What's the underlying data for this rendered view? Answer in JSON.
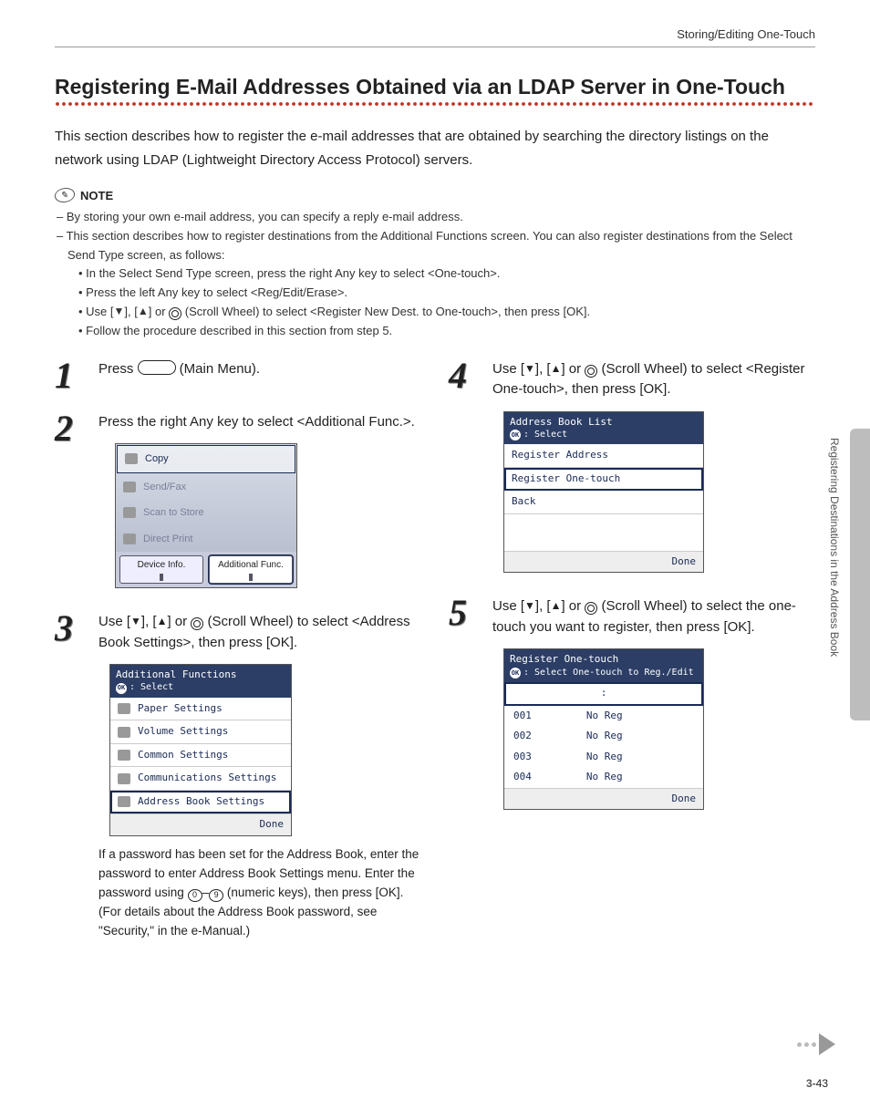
{
  "header": {
    "breadcrumb": "Storing/Editing One-Touch"
  },
  "title": "Registering E-Mail Addresses Obtained via an LDAP Server in One-Touch",
  "intro": "This section describes how to register the e-mail addresses that are obtained by searching the directory listings on the network using LDAP (Lightweight Directory Access Protocol) servers.",
  "note": {
    "label": "NOTE",
    "items": [
      "By storing your own e-mail address, you can specify a reply e-mail address.",
      "This section describes how to register destinations from the Additional Functions screen. You can also register destinations from the Select Send Type screen, as follows:"
    ],
    "sub": [
      "In the Select Send Type screen, press the right Any key to select <One-touch>.",
      "Press the left Any key to select <Reg/Edit/Erase>.",
      "Use [▼], [▲] or (Scroll Wheel) to select <Register New Dest. to One-touch>, then press [OK].",
      "Follow the procedure described in this section from step 5."
    ]
  },
  "steps": {
    "s1": {
      "pre": "Press ",
      "post": " (Main Menu)."
    },
    "s2": {
      "text": "Press the right Any key to select <Additional Func.>.",
      "screen": {
        "rows": [
          "Copy",
          "Send/Fax",
          "Scan to Store",
          "Direct Print"
        ],
        "tabs": [
          "Device Info.",
          "Additional Func."
        ]
      }
    },
    "s3": {
      "pre": "Use [",
      "mid1": "], [",
      "mid2": "] or ",
      "post": " (Scroll Wheel) to select <Address Book Settings>, then press [OK].",
      "screen": {
        "title": "Additional Functions",
        "subtitle": ": Select",
        "rows": [
          "Paper Settings",
          "Volume Settings",
          "Common Settings",
          "Communications Settings",
          "Address Book Settings"
        ],
        "footer": "Done"
      },
      "after": "If a password has been set for the Address Book, enter the password to enter Address Book Settings menu. Enter the password using – (numeric keys), then press [OK]. (For details about the Address Book password, see \"Security,\" in the e-Manual.)"
    },
    "s4": {
      "pre": "Use [",
      "mid1": "], [",
      "mid2": "] or ",
      "post": " (Scroll Wheel) to select <Register One-touch>, then press [OK].",
      "screen": {
        "title": "Address Book List",
        "subtitle": ": Select",
        "rows": [
          "Register Address",
          "Register One-touch",
          "Back"
        ],
        "footer": "Done"
      }
    },
    "s5": {
      "pre": "Use [",
      "mid1": "], [",
      "mid2": "] or ",
      "post": " (Scroll Wheel) to select the one-touch you want to register, then press [OK].",
      "screen": {
        "title": "Register One-touch",
        "subtitle": ": Select One-touch to Reg./Edit",
        "header": ":",
        "rows": [
          {
            "id": "001",
            "status": "No Reg"
          },
          {
            "id": "002",
            "status": "No Reg"
          },
          {
            "id": "003",
            "status": "No Reg"
          },
          {
            "id": "004",
            "status": "No Reg"
          }
        ],
        "footer": "Done"
      }
    }
  },
  "side": "Registering Destinations in the Address Book",
  "page": {
    "chapter": "3-",
    "num": "43"
  },
  "keys": {
    "zero": "0",
    "nine": "9"
  }
}
